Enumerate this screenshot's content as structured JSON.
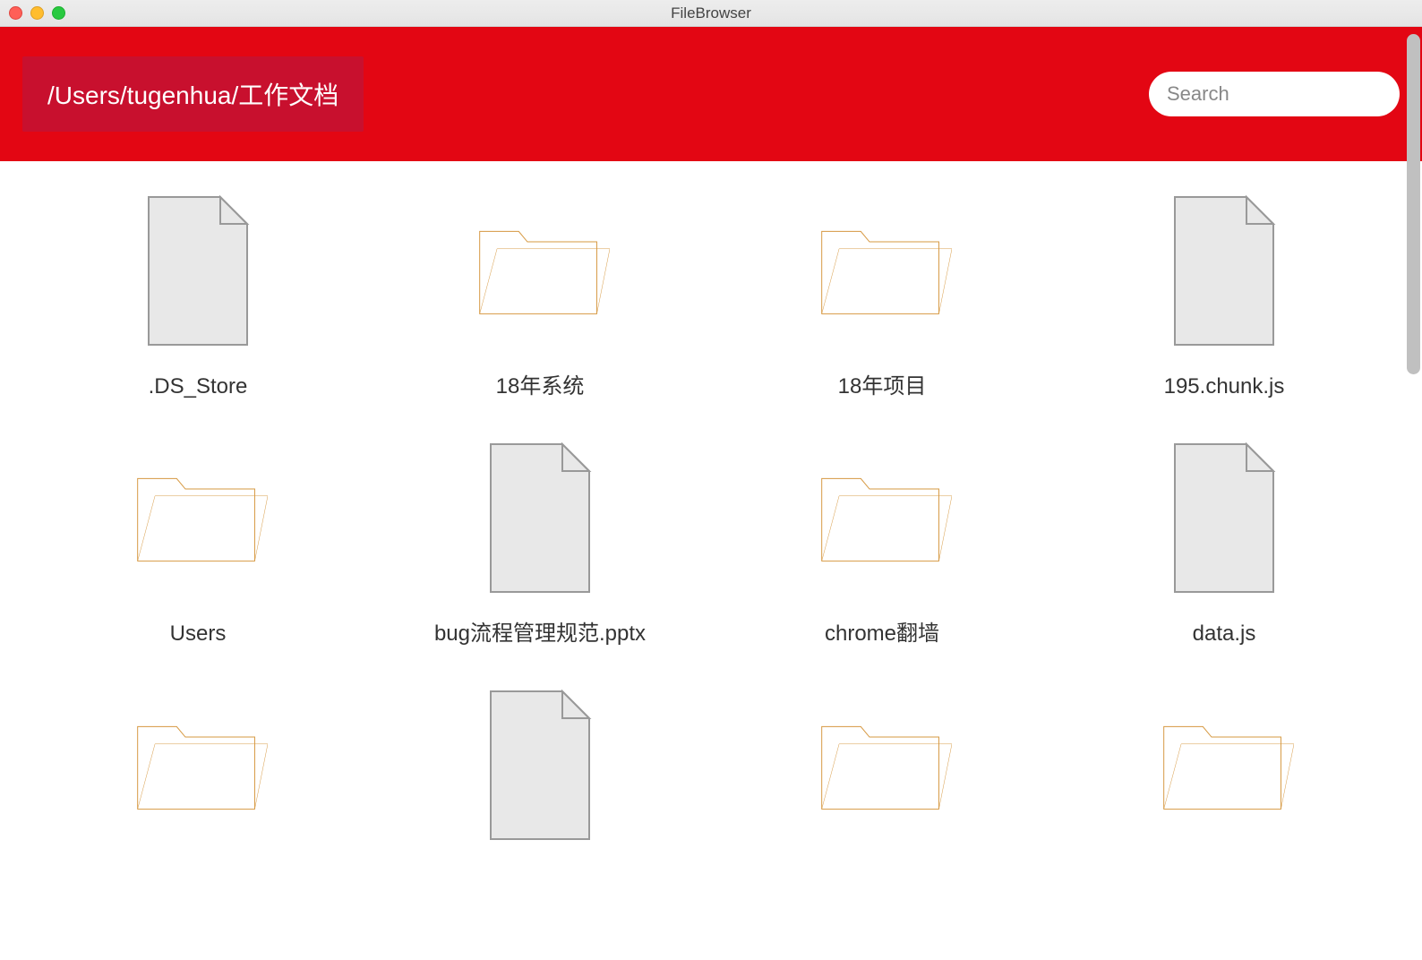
{
  "window": {
    "title": "FileBrowser"
  },
  "header": {
    "path": "/Users/tugenhua/工作文档",
    "search_placeholder": "Search"
  },
  "items": [
    {
      "name": ".DS_Store",
      "type": "file"
    },
    {
      "name": "18年系统",
      "type": "folder"
    },
    {
      "name": "18年项目",
      "type": "folder"
    },
    {
      "name": "195.chunk.js",
      "type": "file"
    },
    {
      "name": "Users",
      "type": "folder"
    },
    {
      "name": "bug流程管理规范.pptx",
      "type": "file"
    },
    {
      "name": "chrome翻墙",
      "type": "folder"
    },
    {
      "name": "data.js",
      "type": "file"
    },
    {
      "name": "",
      "type": "folder"
    },
    {
      "name": "",
      "type": "file"
    },
    {
      "name": "",
      "type": "folder"
    },
    {
      "name": "",
      "type": "folder"
    }
  ]
}
